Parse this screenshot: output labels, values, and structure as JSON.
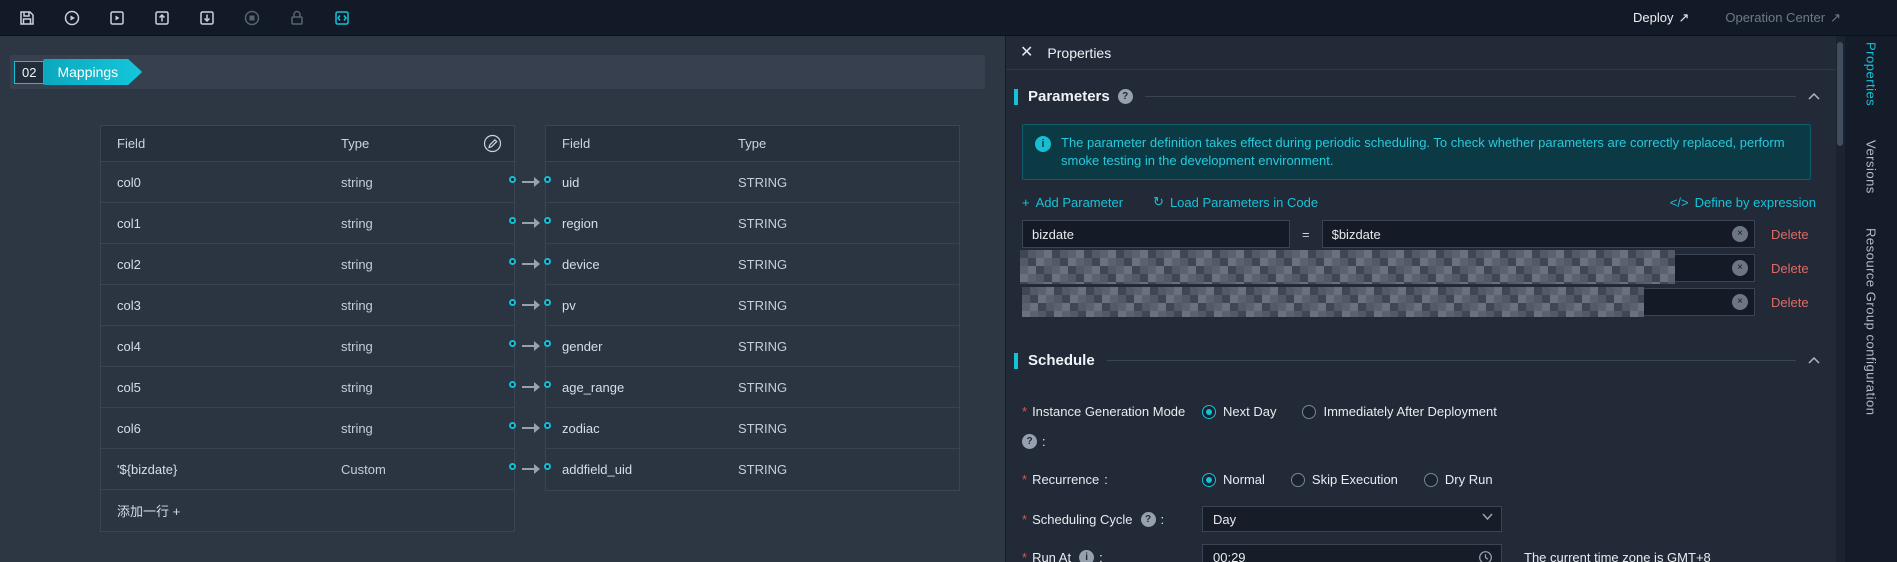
{
  "toolbar": {
    "deploy": "Deploy",
    "operation_center": "Operation Center"
  },
  "mappings": {
    "step": "02",
    "title": "Mappings",
    "source": {
      "header_field": "Field",
      "header_type": "Type",
      "rows": [
        {
          "field": "col0",
          "type": "string"
        },
        {
          "field": "col1",
          "type": "string"
        },
        {
          "field": "col2",
          "type": "string"
        },
        {
          "field": "col3",
          "type": "string"
        },
        {
          "field": "col4",
          "type": "string"
        },
        {
          "field": "col5",
          "type": "string"
        },
        {
          "field": "col6",
          "type": "string"
        },
        {
          "field": "'${bizdate}",
          "type": "Custom"
        }
      ],
      "add_row": "添加一行 +"
    },
    "target": {
      "header_field": "Field",
      "header_type": "Type",
      "rows": [
        {
          "field": "uid",
          "type": "STRING"
        },
        {
          "field": "region",
          "type": "STRING"
        },
        {
          "field": "device",
          "type": "STRING"
        },
        {
          "field": "pv",
          "type": "STRING"
        },
        {
          "field": "gender",
          "type": "STRING"
        },
        {
          "field": "age_range",
          "type": "STRING"
        },
        {
          "field": "zodiac",
          "type": "STRING"
        },
        {
          "field": "addfield_uid",
          "type": "STRING"
        }
      ]
    }
  },
  "panel": {
    "title": "Properties",
    "parameters": {
      "title": "Parameters",
      "info": "The parameter definition takes effect during periodic scheduling. To check whether parameters are correctly replaced, perform smoke testing in the development environment.",
      "add_parameter": "Add Parameter",
      "load_parameters": "Load Parameters in Code",
      "define_by_expression": "Define by expression",
      "equals": "=",
      "delete": "Delete",
      "rows": [
        {
          "name": "bizdate",
          "value": "$bizdate"
        }
      ]
    },
    "schedule": {
      "title": "Schedule",
      "igm_label": "Instance Generation Mode",
      "igm_options": [
        "Next Day",
        "Immediately After Deployment"
      ],
      "recurrence_label": "Recurrence",
      "recurrence_options": [
        "Normal",
        "Skip Execution",
        "Dry Run"
      ],
      "cycle_label": "Scheduling Cycle",
      "cycle_value": "Day",
      "runat_label": "Run At",
      "runat_value": "00:29",
      "timezone_note": "The current time zone is GMT+8"
    }
  },
  "right_tabs": {
    "properties": "Properties",
    "versions": "Versions",
    "resource_group": "Resource Group configuration"
  },
  "glyphs": {
    "close": "✕",
    "close_small": "×",
    "external": "↗",
    "plus": "+",
    "refresh": "↻",
    "code": "</>",
    "question": "?",
    "info": "i",
    "colon": ":",
    "asterisk": "*"
  }
}
